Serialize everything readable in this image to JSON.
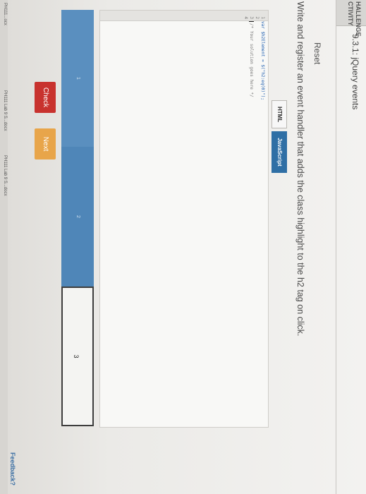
{
  "header": {
    "label_line1": "HALLENGE",
    "label_line2": "CTIVITY",
    "title": "9.3.1: jQuery events"
  },
  "reset_label": "Reset",
  "instruction": "Write and register an event handler that adds the class highlight to the h2 tag on click.",
  "tabs": [
    {
      "label": "HTML",
      "active": false
    },
    {
      "label": "JavaScript",
      "active": true
    }
  ],
  "editor": {
    "lines": [
      {
        "num": "1",
        "code": "var $h2Element = $(\"h2:eq(0)\");"
      },
      {
        "num": "2",
        "code": ""
      },
      {
        "num": "3",
        "code": "/* Your solution goes here */"
      },
      {
        "num": "4",
        "code": ""
      }
    ]
  },
  "progress": {
    "steps": [
      "1",
      "2",
      "3"
    ],
    "current_step": 3
  },
  "buttons": {
    "check": "Check",
    "next": "Next"
  },
  "feedback_label": "Feedback?",
  "downloads": [
    {
      "label": "PH111...ocx"
    },
    {
      "label": "PH111 Lab 9 S...docx"
    },
    {
      "label": "PH111 Lab 9 S...docx"
    }
  ],
  "colors": {
    "check": "#c8322e",
    "next": "#e8a54a",
    "progress": "#4f86b8",
    "active_tab": "#2f6fa5"
  }
}
